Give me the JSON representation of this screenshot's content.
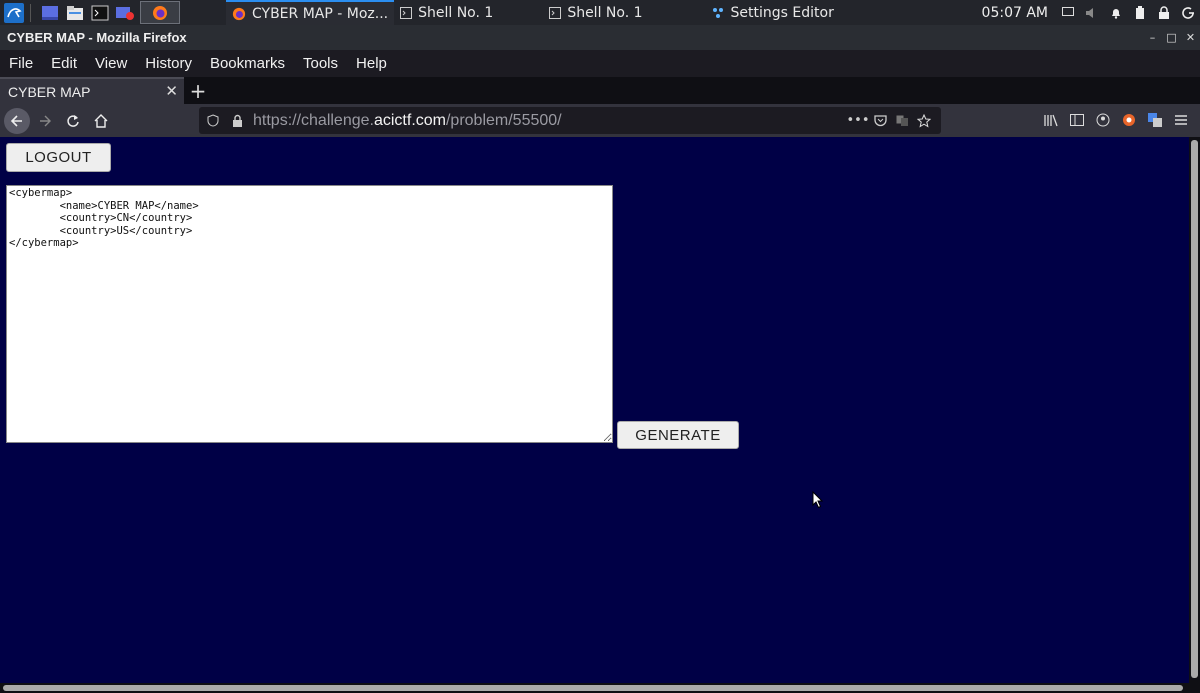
{
  "taskbar": {
    "tasks": [
      {
        "label": "CYBER MAP - Moz...",
        "icon": "firefox-icon",
        "active": true
      },
      {
        "label": "Shell No. 1",
        "icon": "terminal-icon",
        "active": false
      },
      {
        "label": "Shell No. 1",
        "icon": "terminal-icon",
        "active": false
      },
      {
        "label": "Settings Editor",
        "icon": "settings-icon",
        "active": false
      }
    ],
    "clock": "05:07 AM"
  },
  "window": {
    "title": "CYBER MAP - Mozilla Firefox"
  },
  "menubar": {
    "items": [
      "File",
      "Edit",
      "View",
      "History",
      "Bookmarks",
      "Tools",
      "Help"
    ]
  },
  "tabs": {
    "active_label": "CYBER MAP"
  },
  "urlbar": {
    "prefix": "https://challenge.",
    "domain": "acictf.com",
    "path": "/problem/55500/"
  },
  "page": {
    "logout_label": "LOGOUT",
    "xml_content": "<cybermap>\n\t<name>CYBER MAP</name>\n\t<country>CN</country>\n\t<country>US</country>\n</cybermap>",
    "generate_label": "GENERATE"
  },
  "colors": {
    "page_background": "#000046",
    "taskbar_active_accent": "#2b8ef0"
  }
}
